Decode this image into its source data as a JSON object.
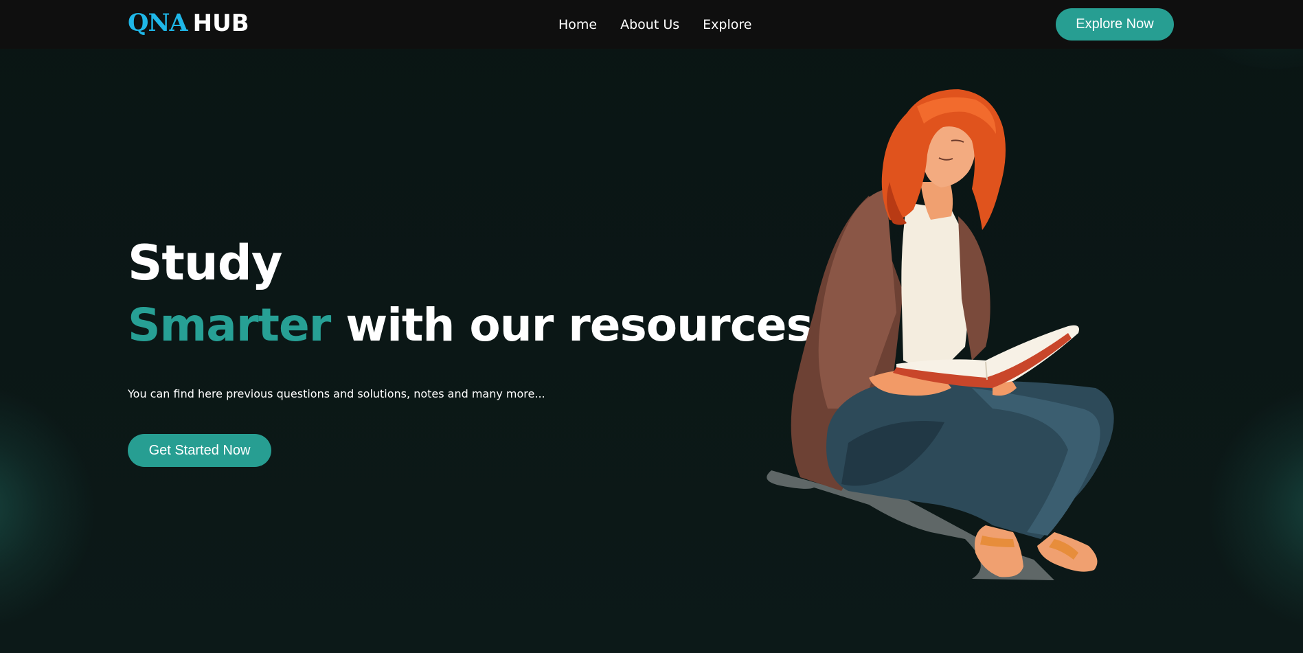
{
  "nav": {
    "logo_primary": "QNA",
    "logo_secondary": "HUB",
    "links": [
      "Home",
      "About Us",
      "Explore"
    ],
    "cta_label": "Explore Now"
  },
  "hero": {
    "heading_line1": "Study",
    "heading_accent": "Smarter",
    "heading_rest": "with our resources",
    "subtitle": "You can find here previous questions and solutions, notes and many more...",
    "cta_label": "Get Started Now",
    "illustration": "woman-reading-book-illustration"
  },
  "colors": {
    "background": "#0c1918",
    "navbar": "#0f0f0f",
    "accent": "#279e92",
    "logo_accent": "#1fb7e8"
  }
}
